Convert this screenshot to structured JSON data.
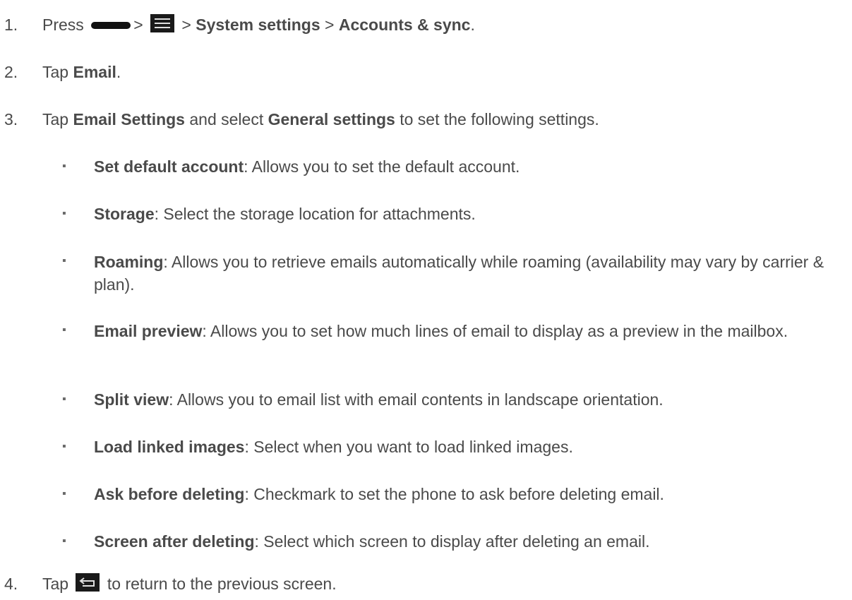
{
  "steps": [
    {
      "number": "1.",
      "parts": {
        "press": "Press",
        "sep1": ">",
        "sep2": ">",
        "system_settings": "System settings",
        "sep3": ">",
        "accounts_sync": "Accounts & sync",
        "end": "."
      },
      "icons": [
        "home-key-icon",
        "menu-icon"
      ]
    },
    {
      "number": "2.",
      "parts": {
        "tap": "Tap",
        "email": "Email",
        "end": "."
      }
    },
    {
      "number": "3.",
      "parts": {
        "tap": "Tap",
        "email_settings": "Email Settings",
        "and_select": "and select",
        "general_settings": "General settings",
        "rest": "to set the following settings."
      }
    },
    {
      "number": "4.",
      "parts": {
        "tap": "Tap",
        "rest": "to return to the previous screen."
      },
      "icons": [
        "back-icon"
      ]
    }
  ],
  "settings": [
    {
      "term": "Set default account",
      "desc": ": Allows you to set the default account."
    },
    {
      "term": "Storage",
      "desc": ": Select the storage location for attachments."
    },
    {
      "term": "Roaming",
      "desc": ": Allows you to retrieve emails automatically while roaming (availability may vary by carrier & plan)."
    },
    {
      "term": "Email preview",
      "desc": ": Allows you to set how much lines of email to display as a preview in the mailbox."
    },
    {
      "term": "Split view",
      "desc": ": Allows you to email list with email contents in landscape orientation."
    },
    {
      "term": "Load linked images",
      "desc": ": Select when you want to load linked images."
    },
    {
      "term": "Ask before deleting",
      "desc": ": Checkmark to set the phone to ask before deleting email."
    },
    {
      "term": "Screen after deleting",
      "desc": ": Select which screen to display after deleting an email."
    }
  ],
  "bullet_glyph": "▪",
  "colors": {
    "text": "#4a4a4a",
    "icon_bg": "#1a1a1a"
  }
}
